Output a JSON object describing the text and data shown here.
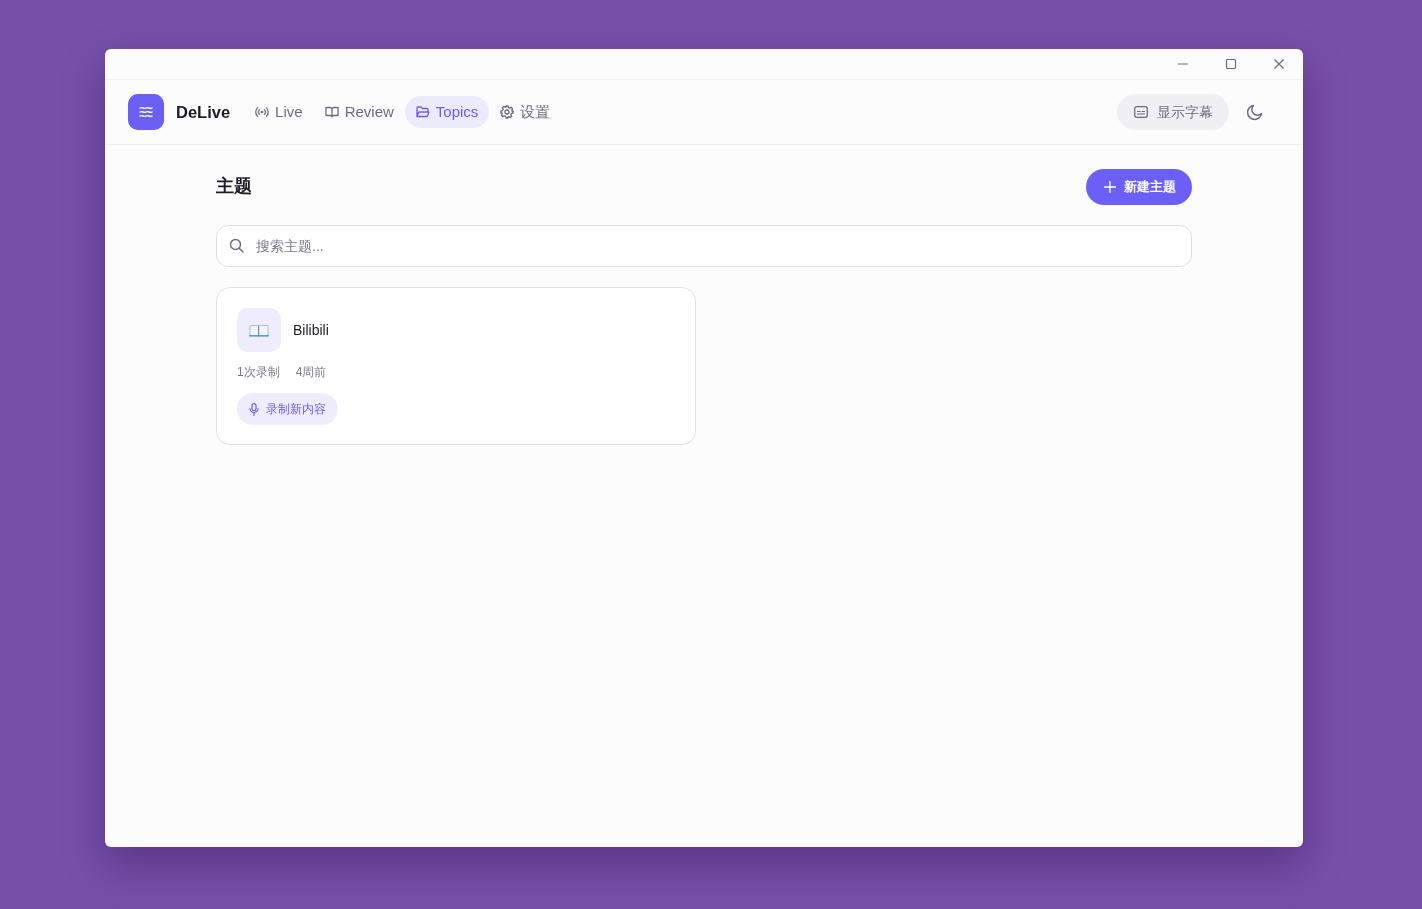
{
  "app": {
    "name": "DeLive"
  },
  "nav_tabs": [
    {
      "label": "Live",
      "kind": "live",
      "selected": false
    },
    {
      "label": "Review",
      "kind": "review",
      "selected": false
    },
    {
      "label": "Topics",
      "kind": "topics",
      "selected": true
    },
    {
      "label": "设置",
      "kind": "settings",
      "selected": false
    }
  ],
  "subtitle_button": {
    "label": "显示字幕"
  },
  "page": {
    "title": "主题",
    "new_button": "新建主题"
  },
  "search": {
    "placeholder": "搜索主题..."
  },
  "topics": [
    {
      "name": "Bilibili",
      "recordings": "1次录制",
      "updated": "4周前",
      "action": "录制新内容"
    }
  ]
}
